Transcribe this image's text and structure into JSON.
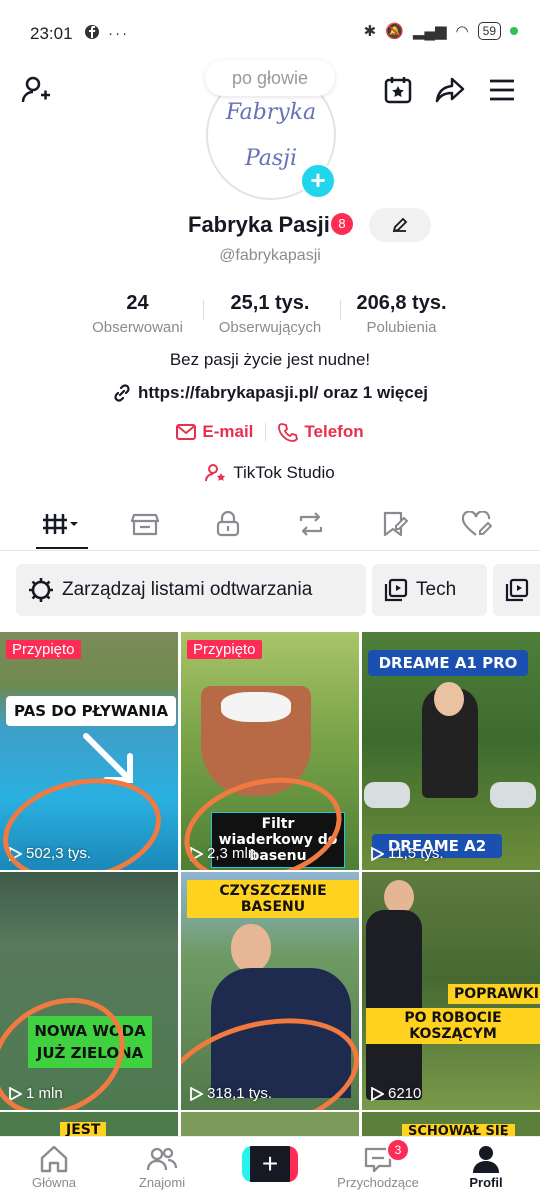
{
  "status_bar": {
    "time": "23:01",
    "left_icons": "⬤ ···",
    "battery": "59"
  },
  "profile": {
    "avatar_tooltip": "po głowie",
    "avatar_logo_line1": "Fabryka",
    "avatar_logo_line2": "Pasji",
    "name": "Fabryka Pasji",
    "name_badge": "8",
    "handle": "@fabrykapasji",
    "stats": [
      {
        "value": "24",
        "label": "Obserwowani"
      },
      {
        "value": "25,1 tys.",
        "label": "Obserwujących"
      },
      {
        "value": "206,8 tys.",
        "label": "Polubienia"
      }
    ],
    "bio": "Bez pasji życie jest nudne!",
    "link": "https://fabrykapasji.pl/ oraz 1 więcej",
    "email_label": "E-mail",
    "phone_label": "Telefon",
    "studio_label": "TikTok Studio"
  },
  "playlists": {
    "manage_label": "Zarządzaj listami odtwarzania",
    "tech_label": "Tech"
  },
  "videos": [
    {
      "pinned": "Przypięto",
      "caption": "PAS DO PŁYWANIA",
      "views": "502,3 tys."
    },
    {
      "pinned": "Przypięto",
      "caption": "Filtr wiaderkowy do basenu",
      "views": "2,3 mln"
    },
    {
      "caption": "DREAME A1 PRO",
      "caption2": "DREAME A2",
      "views": "11,5 tys."
    },
    {
      "caption": "NOWA WODA JUŻ ZIELONA",
      "views": "1 mln"
    },
    {
      "caption": "CZYSZCZENIE BASENU",
      "views": "318,1 tys."
    },
    {
      "caption": "POPRAWKI PO ROBOCIE KOSZĄCYM",
      "views": "6210"
    }
  ],
  "bottom_strip": {
    "caption_a": "JEST",
    "caption_c": "SCHOWAŁ SIĘ"
  },
  "bottom_nav": {
    "home": "Główna",
    "friends": "Znajomi",
    "create": "+",
    "inbox": "Przychodzące",
    "inbox_badge": "3",
    "profile": "Profil"
  },
  "colors": {
    "accent": "#fe2c55",
    "annotation": "#f07a3f"
  }
}
